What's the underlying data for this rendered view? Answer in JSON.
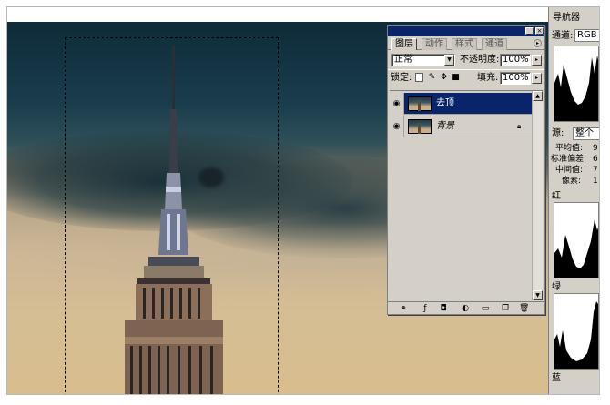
{
  "layers_panel": {
    "tabs": [
      "图层",
      "动作",
      "样式",
      "通道"
    ],
    "active_tab": 0,
    "blend_mode": "正常",
    "opacity_label": "不透明度:",
    "opacity_value": "100%",
    "lock_label": "锁定:",
    "fill_label": "填充:",
    "fill_value": "100%",
    "layers": [
      {
        "name": "去顶",
        "selected": true,
        "visible": true,
        "locked": false
      },
      {
        "name": "背景",
        "selected": false,
        "visible": true,
        "locked": true
      }
    ]
  },
  "histogram_panel": {
    "tab_label": "导航器",
    "channel_label": "通道:",
    "channel_value": "RGB",
    "source_label": "源:",
    "source_value": "整个",
    "stats": [
      {
        "label": "平均值:",
        "value": "9"
      },
      {
        "label": "标准偏差:",
        "value": "6"
      },
      {
        "label": "中间值:",
        "value": "7"
      },
      {
        "label": "像素:",
        "value": "1"
      }
    ],
    "channel_labels": {
      "red": "红",
      "green": "绿",
      "blue": "蓝"
    }
  },
  "colors": {
    "selection_blue": "#0a246a",
    "panel_gray": "#d4d0c8"
  }
}
